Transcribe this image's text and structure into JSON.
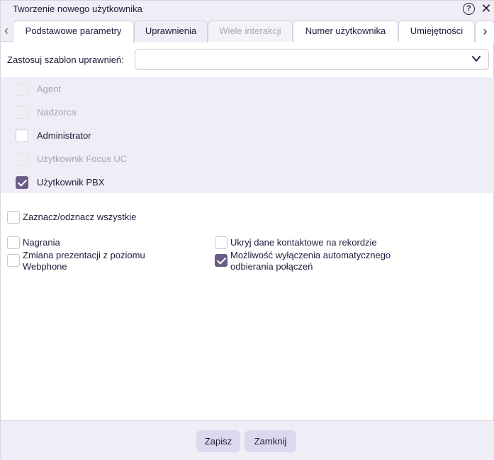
{
  "window": {
    "title": "Tworzenie nowego użytkownika"
  },
  "tabs": [
    {
      "label": "Podstawowe parametry",
      "state": "normal"
    },
    {
      "label": "Uprawnienia",
      "state": "active"
    },
    {
      "label": "Wiele interakcji",
      "state": "disabled"
    },
    {
      "label": "Numer użytkownika",
      "state": "normal"
    },
    {
      "label": "Umiejętności",
      "state": "normal"
    }
  ],
  "template": {
    "label": "Zastosuj szablon uprawnień:",
    "value": ""
  },
  "roles": [
    {
      "label": "Agent",
      "checked": false,
      "disabled": true
    },
    {
      "label": "Nadzorca",
      "checked": false,
      "disabled": true
    },
    {
      "label": "Administrator",
      "checked": false,
      "disabled": false
    },
    {
      "label": "Użytkownik Focus UC",
      "checked": false,
      "disabled": true
    },
    {
      "label": "Użytkownik PBX",
      "checked": true,
      "disabled": false
    }
  ],
  "select_all": {
    "label": "Zaznacz/odznacz wszystkie",
    "checked": false
  },
  "options": {
    "recordings": {
      "label": "Nagrania",
      "checked": false
    },
    "hide_contact": {
      "label": "Ukryj dane kontaktowe na rekordzie",
      "checked": false
    },
    "presentation_line1": "Zmiana prezentacji z poziomu",
    "presentation_line2": "Webphone",
    "presentation_checked": false,
    "auto_answer_line1": "Możliwość wyłączenia automatycznego",
    "auto_answer_line2": "odbierania połączeń",
    "auto_answer_checked": true
  },
  "footer": {
    "save_label": "Zapisz",
    "close_label": "Zamknij"
  },
  "colors": {
    "accent": "#6a5b87",
    "panel": "#efedf5",
    "button": "#ddd8ef"
  }
}
